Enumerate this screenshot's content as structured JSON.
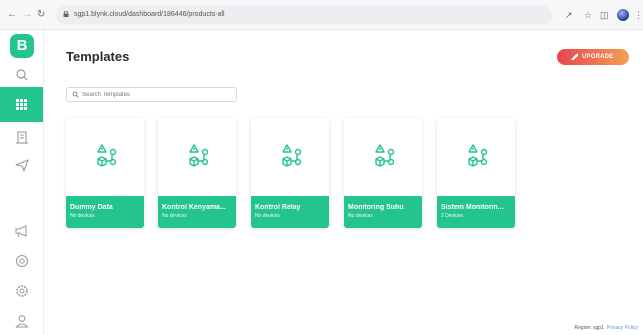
{
  "browser": {
    "url": "sgp1.blynk.cloud/dashboard/186446/products-all"
  },
  "header": {
    "title": "Templates",
    "upgrade_label": "UPGRADE"
  },
  "search": {
    "placeholder": "Search Templates",
    "value": ""
  },
  "logo": {
    "letter": "B"
  },
  "templates": [
    {
      "name": "Dummy Data",
      "devices": "No devices"
    },
    {
      "name": "Kontrol Kenyama...",
      "devices": "No devices"
    },
    {
      "name": "Kontrol Relay",
      "devices": "No devices"
    },
    {
      "name": "Monitoring Suhu",
      "devices": "No devices"
    },
    {
      "name": "Sistem Monitorin...",
      "devices": "2 Devices"
    }
  ],
  "footer": {
    "region": "Region: sgp1",
    "privacy": "Privacy Policy"
  },
  "colors": {
    "brand": "#23c48e",
    "upgrade_start": "#e8454f",
    "upgrade_end": "#f3a052"
  },
  "icons": {
    "sidebar": [
      "search-icon",
      "grid-icon",
      "building-icon",
      "send-icon",
      "megaphone-icon",
      "help-icon",
      "settings-icon",
      "user-icon"
    ],
    "template_art": "device-settings-icon"
  }
}
